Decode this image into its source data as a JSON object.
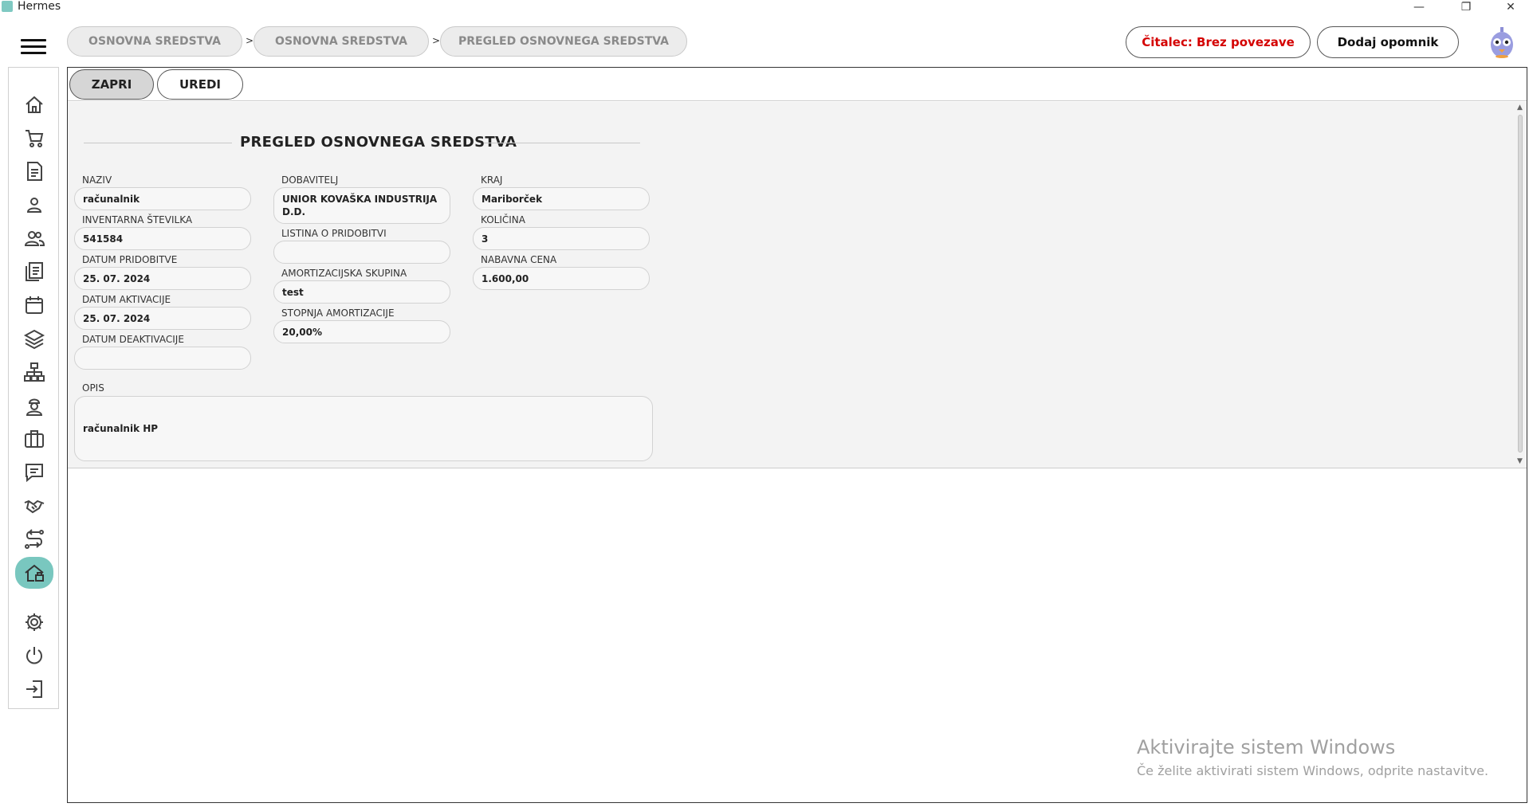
{
  "window": {
    "title": "Hermes",
    "minimize_icon": "minimize-icon",
    "restore_icon": "restore-icon",
    "close_icon": "close-icon"
  },
  "breadcrumb": [
    {
      "label": "OSNOVNA SREDSTVA"
    },
    {
      "label": "OSNOVNA SREDSTVA"
    },
    {
      "label": "PREGLED OSNOVNEGA SREDSTVA"
    }
  ],
  "breadcrumb_separator": ">",
  "header": {
    "reader_status": "Čitalec: Brez povezave",
    "reader_status_color": "#d40000",
    "add_reminder": "Dodaj opomnik"
  },
  "sidebar": {
    "items": [
      {
        "icon": "home-icon"
      },
      {
        "icon": "cart-icon"
      },
      {
        "icon": "document-icon"
      },
      {
        "icon": "person-icon"
      },
      {
        "icon": "people-icon"
      },
      {
        "icon": "documents-icon"
      },
      {
        "icon": "calendar-icon"
      },
      {
        "icon": "layers-icon"
      },
      {
        "icon": "network-icon"
      },
      {
        "icon": "worker-icon"
      },
      {
        "icon": "briefcase-icon"
      },
      {
        "icon": "chat-icon"
      },
      {
        "icon": "handshake-icon"
      },
      {
        "icon": "route-icon"
      },
      {
        "icon": "asset-home-icon",
        "active": true
      },
      {
        "icon": "gear-icon"
      },
      {
        "icon": "power-icon"
      },
      {
        "icon": "logout-icon"
      }
    ],
    "active_color": "#79c7bf"
  },
  "toolbar": {
    "close_label": "ZAPRI",
    "edit_label": "UREDI"
  },
  "form": {
    "title": "PREGLED OSNOVNEGA SREDSTVA",
    "naziv": {
      "label": "NAZIV",
      "value": "računalnik"
    },
    "inventarna": {
      "label": "INVENTARNA ŠTEVILKA",
      "value": "541584"
    },
    "datum_pridobitve": {
      "label": "DATUM PRIDOBITVE",
      "value": "25. 07. 2024"
    },
    "datum_aktivacije": {
      "label": "DATUM AKTIVACIJE",
      "value": "25. 07. 2024"
    },
    "datum_deaktivacije": {
      "label": "DATUM DEAKTIVACIJE",
      "value": ""
    },
    "dobavitelj": {
      "label": "DOBAVITELJ",
      "value": "UNIOR KOVAŠKA INDUSTRIJA D.D."
    },
    "listina": {
      "label": "LISTINA O PRIDOBITVI",
      "value": ""
    },
    "amort_skupina": {
      "label": "AMORTIZACIJSKA SKUPINA",
      "value": "test"
    },
    "stopnja": {
      "label": "STOPNJA AMORTIZACIJE",
      "value": "20,00%"
    },
    "kraj": {
      "label": "KRAJ",
      "value": "Mariborček"
    },
    "kolicina": {
      "label": "KOLIČINA",
      "value": "3"
    },
    "nabavna": {
      "label": "NABAVNA CENA",
      "value": "1.600,00"
    },
    "opis": {
      "label": "OPIS",
      "value": "računalnik HP"
    }
  },
  "watermark": {
    "line1": "Aktivirajte sistem Windows",
    "line2": "Če želite aktivirati sistem Windows, odprite nastavitve."
  }
}
